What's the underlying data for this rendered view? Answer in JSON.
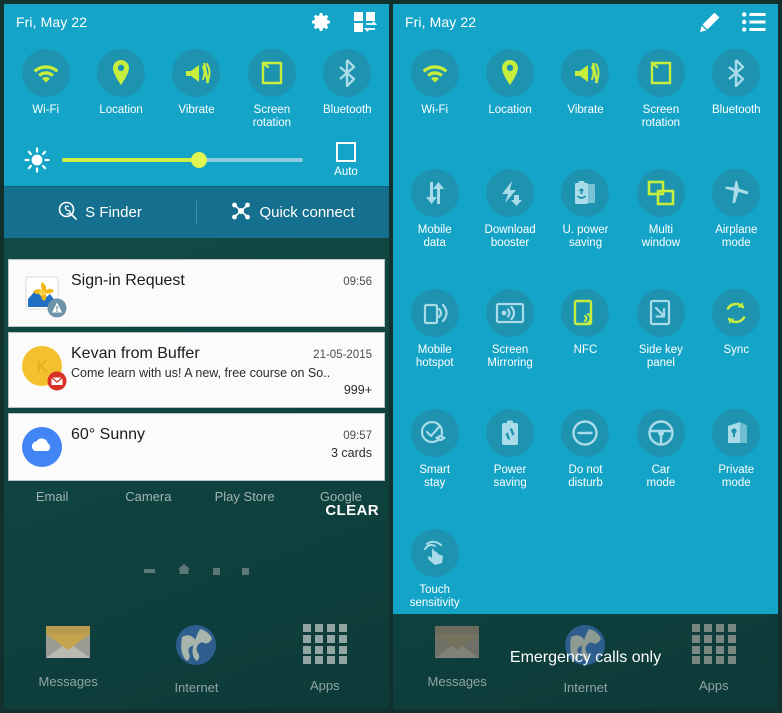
{
  "colors": {
    "panel_accent": "#14a4c8",
    "toggle_circle": "#1d93b0",
    "toggle_active": "#c8ee3d",
    "toggle_inactive": "#a9dbe8",
    "finder_bar": "#14708e",
    "slider_fill": "#cdf04a",
    "slider_track": "#8fcbe0",
    "wallpaper": "#104743",
    "notification_bg": "#fbfbfb"
  },
  "left_panel": {
    "statusbar": {
      "date": "Fri, May 22",
      "icons": [
        {
          "name": "settings-gear-icon",
          "label": "Settings"
        },
        {
          "name": "quick-settings-grid-icon",
          "label": "Edit quick settings"
        }
      ]
    },
    "toggles": [
      {
        "label": "Wi-Fi",
        "icon": "wifi-icon",
        "active": true
      },
      {
        "label": "Location",
        "icon": "location-pin-icon",
        "active": true
      },
      {
        "label": "Vibrate",
        "icon": "vibrate-icon",
        "active": true
      },
      {
        "label": "Screen\nrotation",
        "label_line1": "Screen",
        "label_line2": "rotation",
        "icon": "screen-rotation-icon",
        "active": true
      },
      {
        "label": "Bluetooth",
        "icon": "bluetooth-icon",
        "active": false
      }
    ],
    "brightness": {
      "icon": "brightness-icon",
      "value_percent": 57,
      "auto_label": "Auto",
      "auto_checked": false
    },
    "finder_bar": [
      {
        "label": "S Finder",
        "icon": "s-finder-icon"
      },
      {
        "label": "Quick connect",
        "icon": "quick-connect-icon"
      }
    ],
    "notifications": [
      {
        "title": "Sign-in Request",
        "meta": "09:56",
        "sub": "",
        "count": "",
        "icon": "photos-app-icon",
        "badge": "warning-badge"
      },
      {
        "title": "Kevan from Buffer",
        "meta": "21-05-2015",
        "sub": "Come learn with us! A new, free course on So..",
        "count": "999+",
        "icon": "contact-avatar-k",
        "badge": "gmail-badge"
      },
      {
        "title": "60° Sunny",
        "meta": "09:57",
        "sub": "",
        "count": "3 cards",
        "icon": "weather-cloud-icon",
        "badge": ""
      }
    ],
    "clear_label": "CLEAR",
    "home": {
      "app_labels": [
        "Email",
        "Camera",
        "Play Store",
        "Google"
      ],
      "dock": [
        {
          "label": "Messages",
          "icon": "messages-envelope-icon"
        },
        {
          "label": "Internet",
          "icon": "internet-globe-icon"
        },
        {
          "label": "Apps",
          "icon": "apps-grid-icon"
        }
      ]
    }
  },
  "right_panel": {
    "statusbar": {
      "date": "Fri, May 22",
      "icons": [
        {
          "name": "edit-pencil-icon",
          "label": "Edit"
        },
        {
          "name": "list-view-icon",
          "label": "List view"
        }
      ]
    },
    "toggle_rows": [
      [
        {
          "label_line1": "Wi-Fi",
          "label_line2": "",
          "icon": "wifi-icon",
          "active": true
        },
        {
          "label_line1": "Location",
          "label_line2": "",
          "icon": "location-pin-icon",
          "active": true
        },
        {
          "label_line1": "Vibrate",
          "label_line2": "",
          "icon": "vibrate-icon",
          "active": true
        },
        {
          "label_line1": "Screen",
          "label_line2": "rotation",
          "icon": "screen-rotation-icon",
          "active": true
        },
        {
          "label_line1": "Bluetooth",
          "label_line2": "",
          "icon": "bluetooth-icon",
          "active": false
        }
      ],
      [
        {
          "label_line1": "Mobile",
          "label_line2": "data",
          "icon": "mobile-data-icon",
          "active": false
        },
        {
          "label_line1": "Download",
          "label_line2": "booster",
          "icon": "download-booster-icon",
          "active": false
        },
        {
          "label_line1": "U. power",
          "label_line2": "saving",
          "icon": "ultra-power-saving-icon",
          "active": false
        },
        {
          "label_line1": "Multi",
          "label_line2": "window",
          "icon": "multi-window-icon",
          "active": true
        },
        {
          "label_line1": "Airplane",
          "label_line2": "mode",
          "icon": "airplane-mode-icon",
          "active": false
        }
      ],
      [
        {
          "label_line1": "Mobile",
          "label_line2": "hotspot",
          "icon": "mobile-hotspot-icon",
          "active": false
        },
        {
          "label_line1": "Screen",
          "label_line2": "Mirroring",
          "icon": "screen-mirroring-icon",
          "active": false
        },
        {
          "label_line1": "NFC",
          "label_line2": "",
          "icon": "nfc-icon",
          "active": true
        },
        {
          "label_line1": "Side key",
          "label_line2": "panel",
          "icon": "side-key-panel-icon",
          "active": false
        },
        {
          "label_line1": "Sync",
          "label_line2": "",
          "icon": "sync-icon",
          "active": true
        }
      ],
      [
        {
          "label_line1": "Smart",
          "label_line2": "stay",
          "icon": "smart-stay-icon",
          "active": false
        },
        {
          "label_line1": "Power",
          "label_line2": "saving",
          "icon": "power-saving-icon",
          "active": false
        },
        {
          "label_line1": "Do not",
          "label_line2": "disturb",
          "icon": "do-not-disturb-icon",
          "active": false
        },
        {
          "label_line1": "Car",
          "label_line2": "mode",
          "icon": "car-mode-icon",
          "active": false
        },
        {
          "label_line1": "Private",
          "label_line2": "mode",
          "icon": "private-mode-icon",
          "active": false
        }
      ],
      [
        {
          "label_line1": "Touch",
          "label_line2": "sensitivity",
          "icon": "touch-sensitivity-icon",
          "active": false
        }
      ]
    ],
    "emergency_text": "Emergency calls only",
    "home": {
      "dock": [
        {
          "label": "Messages",
          "icon": "messages-envelope-icon"
        },
        {
          "label": "Internet",
          "icon": "internet-globe-icon"
        },
        {
          "label": "Apps",
          "icon": "apps-grid-icon"
        }
      ]
    }
  }
}
